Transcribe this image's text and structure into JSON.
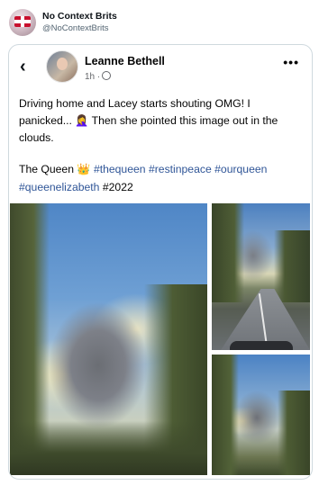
{
  "tweet": {
    "name": "No Context Brits",
    "handle": "@NoContextBrits"
  },
  "post": {
    "author": "Leanne Bethell",
    "time": "1h ·",
    "text": "Driving home and Lacey starts shouting OMG! I panicked... 🤦‍♀️ Then she pointed this image out in the clouds.",
    "prefix": "The Queen 👑",
    "hashtags": [
      "#thequeen",
      "#restinpeace",
      "#ourqueen",
      "#queenelizabeth"
    ],
    "suffix": "#2022"
  },
  "icons": {
    "back": "chevron-left-icon",
    "more": "more-horizontal-icon",
    "audience": "globe-icon"
  },
  "colors": {
    "hashtag": "#2f5597",
    "handle": "#536471",
    "border": "#cfd9de"
  }
}
